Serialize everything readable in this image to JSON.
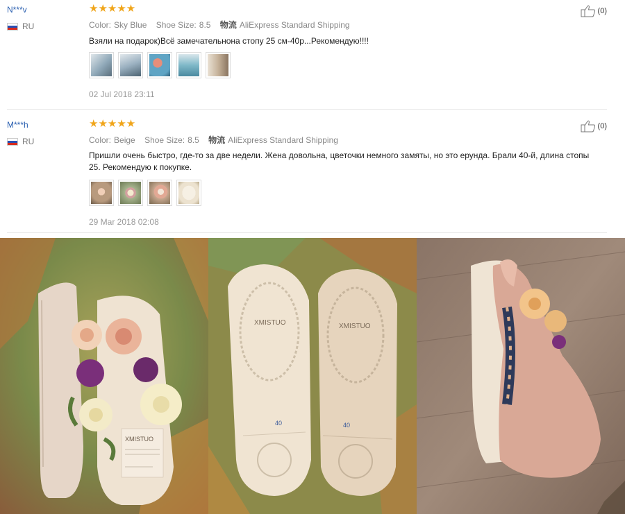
{
  "reviews": [
    {
      "user": "N***v",
      "country": "RU",
      "stars": "★★★★★",
      "color_label": "Color:",
      "color": "Sky Blue",
      "size_label": "Shoe Size:",
      "size": "8.5",
      "shipping_label": "物流",
      "shipping": "AliExpress Standard Shipping",
      "text": "Взяли на подарок)Всё замечательнона стопу 25 см-40р...Рекомендую!!!!",
      "date": "02 Jul 2018 23:11",
      "helpful": "(0)",
      "thumb_colors": [
        "#8fa8b8",
        "#9ab0c0",
        "#5fa4c4",
        "#7fb8c8",
        "#c6b29a"
      ]
    },
    {
      "user": "M***h",
      "country": "RU",
      "stars": "★★★★★",
      "color_label": "Color:",
      "color": "Beige",
      "size_label": "Shoe Size:",
      "size": "8.5",
      "shipping_label": "物流",
      "shipping": "AliExpress Standard Shipping",
      "text": "Пришли очень быстро, где-то за две недели. Жена довольна, цветочки немного замяты, но это ерунда. Брали 40-й, длина стопы 25. Рекомендую к покупке.",
      "date": "29 Mar 2018 02:08",
      "helpful": "(0)",
      "thumb_colors": [
        "#b89a7e",
        "#a7b48e",
        "#c8a890",
        "#ece2cf"
      ]
    }
  ],
  "photos": {
    "brand": "XMISTUO",
    "size_mark_left": "40",
    "size_mark_right": "40",
    "colors": {
      "floor": "#7a8a4a",
      "sole": "#efe3d2",
      "wood": "#9a8272",
      "rose_pink": "#eab49a",
      "rose_cream": "#f5edc8",
      "purple": "#7a2f7a"
    }
  }
}
